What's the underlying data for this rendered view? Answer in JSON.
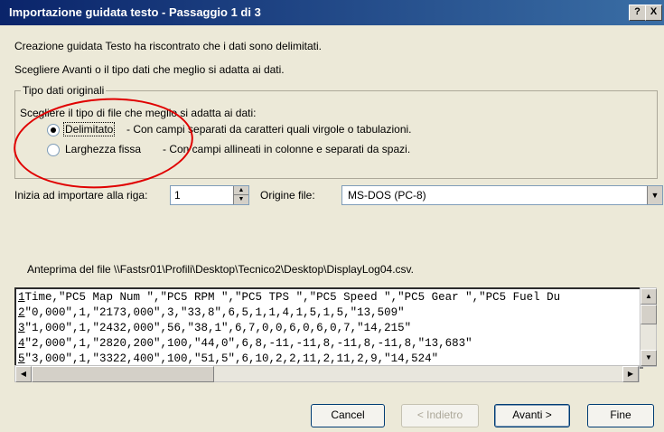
{
  "window": {
    "title": "Importazione guidata testo - Passaggio 1 di 3",
    "help_label": "?",
    "close_label": "X"
  },
  "intro": {
    "line1": "Creazione guidata Testo ha riscontrato che i dati sono delimitati.",
    "line2": "Scegliere Avanti o il tipo dati che meglio si adatta ai dati."
  },
  "group": {
    "legend": "Tipo dati originali",
    "instruction": "Scegliere il tipo di file che meglio si adatta ai dati:",
    "options": [
      {
        "label": "Delimitato",
        "description": "- Con campi separati da caratteri quali virgole o tabulazioni.",
        "selected": true
      },
      {
        "label": "Larghezza fissa",
        "description": "- Con campi allineati in colonne e separati da spazi.",
        "selected": false
      }
    ]
  },
  "start_row": {
    "label": "Inizia ad importare alla riga:",
    "value": "1"
  },
  "origin": {
    "label": "Origine file:",
    "value": "MS-DOS (PC-8)"
  },
  "preview": {
    "label": "Anteprima del file \\\\Fastsr01\\Profili\\Desktop\\Tecnico2\\Desktop\\DisplayLog04.csv.",
    "rows": [
      {
        "num": "1",
        "text": "Time,\"PC5 Map Num \",\"PC5 RPM \",\"PC5 TPS \",\"PC5 Speed \",\"PC5 Gear \",\"PC5 Fuel Du"
      },
      {
        "num": "2",
        "text": "\"0,000\",1,\"2173,000\",3,\"33,8\",6,5,1,1,4,1,5,1,5,\"13,509\""
      },
      {
        "num": "3",
        "text": "\"1,000\",1,\"2432,000\",56,\"38,1\",6,7,0,0,6,0,6,0,7,\"14,215\""
      },
      {
        "num": "4",
        "text": "\"2,000\",1,\"2820,200\",100,\"44,0\",6,8,-11,-11,8,-11,8,-11,8,\"13,683\""
      },
      {
        "num": "5",
        "text": "\"3,000\",1,\"3322,400\",100,\"51,5\",6,10,2,2,11,2,11,2,9,\"14,524\""
      }
    ]
  },
  "buttons": {
    "cancel": "Cancel",
    "back": "< Indietro",
    "next": "Avanti >",
    "finish": "Fine"
  },
  "colors": {
    "annotation": "#e00000",
    "titlebar_start": "#0a246a",
    "titlebar_end": "#3a6ea5"
  }
}
